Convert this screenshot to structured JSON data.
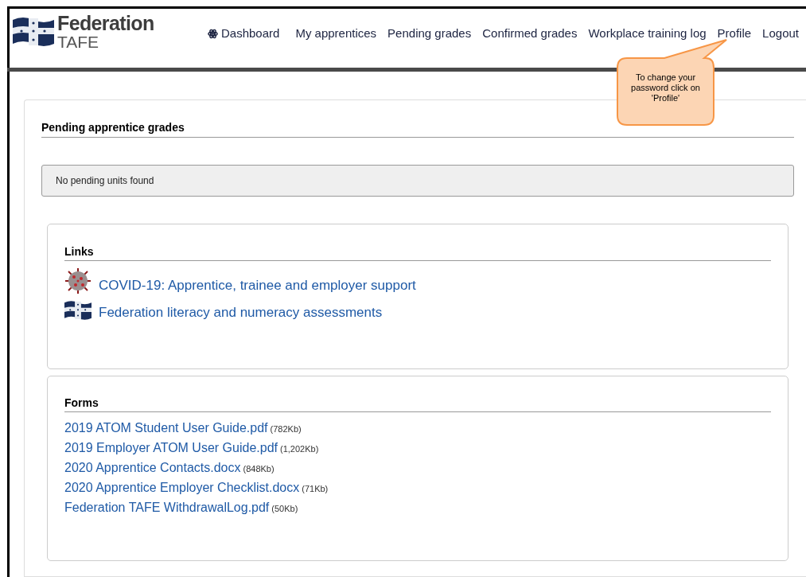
{
  "logo": {
    "name": "Federation",
    "sub": "TAFE"
  },
  "nav": [
    {
      "label": "Dashboard",
      "kind": "icon"
    },
    {
      "label": "My apprentices",
      "kind": "plain"
    },
    {
      "label": "Pending grades",
      "kind": "plain"
    },
    {
      "label": "Confirmed grades",
      "kind": "plain"
    },
    {
      "label": "Workplace training log",
      "kind": "plain"
    },
    {
      "label": "Profile",
      "kind": "plain"
    },
    {
      "label": "Logout",
      "kind": "plain"
    }
  ],
  "callout": "To change your password click on 'Profile'",
  "pending": {
    "title": "Pending apprentice grades",
    "message": "No pending units found"
  },
  "links": {
    "title": "Links",
    "items": [
      {
        "label": "COVID-19: Apprentice, trainee and employer support",
        "kind": "virus"
      },
      {
        "label": "Federation literacy and numeracy assessments",
        "kind": "flag"
      }
    ]
  },
  "forms": {
    "title": "Forms",
    "items": [
      {
        "label": "2019 ATOM Student User Guide.pdf",
        "size": "(782Kb)"
      },
      {
        "label": "2019 Employer ATOM User Guide.pdf",
        "size": "(1,202Kb)"
      },
      {
        "label": "2020 Apprentice Contacts.docx",
        "size": "(848Kb)"
      },
      {
        "label": "2020 Apprentice Employer Checklist.docx",
        "size": "(71Kb)"
      },
      {
        "label": "Federation TAFE WithdrawalLog.pdf",
        "size": "(50Kb)"
      }
    ]
  }
}
